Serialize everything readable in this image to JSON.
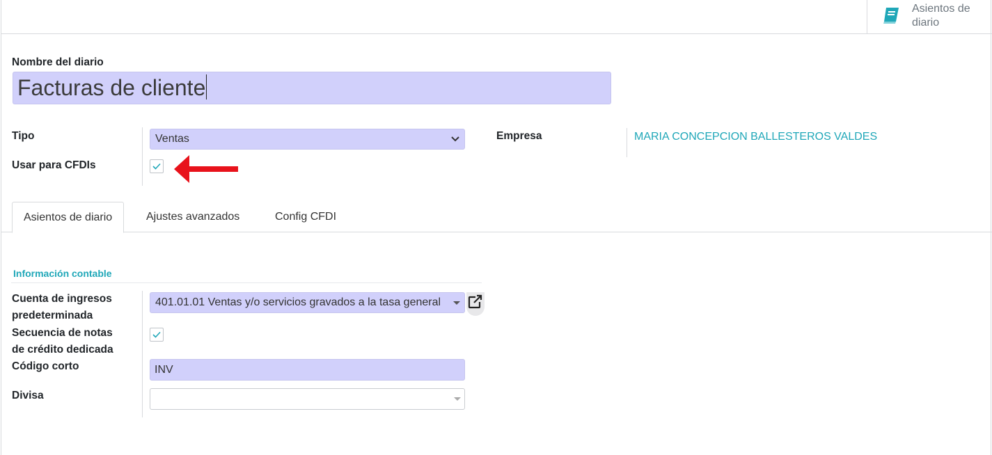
{
  "smart_button": {
    "label": "Asientos de diario",
    "icon": "book-icon"
  },
  "form": {
    "name_label": "Nombre del diario",
    "name_value": "Facturas de cliente",
    "tipo_label": "Tipo",
    "tipo_value": "Ventas",
    "cfdi_label": "Usar para CFDIs",
    "cfdi_checked": true,
    "empresa_label": "Empresa",
    "empresa_value": "MARIA CONCEPCION BALLESTEROS VALDES"
  },
  "tabs": [
    {
      "label": "Asientos de diario",
      "active": true
    },
    {
      "label": "Ajustes avanzados",
      "active": false
    },
    {
      "label": "Config CFDI",
      "active": false
    }
  ],
  "accounting": {
    "section_title": "Información contable",
    "cuenta_label_line1": "Cuenta de ingresos",
    "cuenta_label_line2": "predeterminada",
    "cuenta_value": "401.01.01 Ventas y/o servicios gravados a la tasa general",
    "secuencia_label_line1": "Secuencia de notas",
    "secuencia_label_line2": "de crédito dedicada",
    "secuencia_checked": true,
    "codigo_label": "Código corto",
    "codigo_value": "INV",
    "divisa_label": "Divisa",
    "divisa_value": ""
  },
  "colors": {
    "accent": "#1fa7b8",
    "input_bg": "#d1d0fb",
    "arrow": "#e8121b"
  }
}
